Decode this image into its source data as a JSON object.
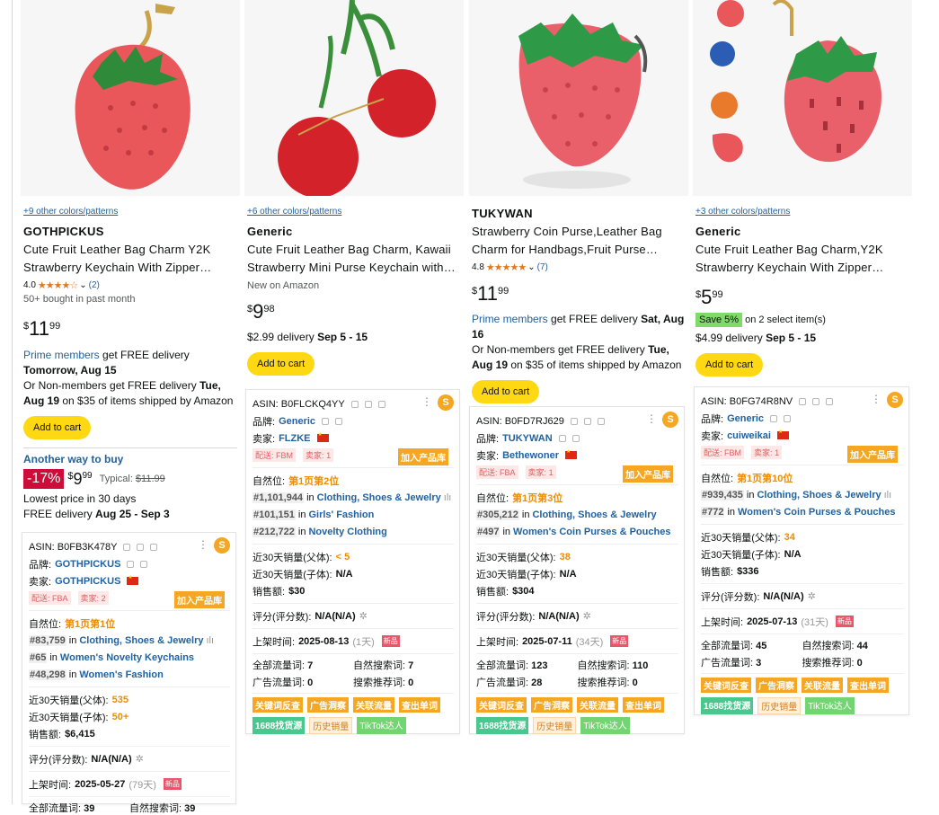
{
  "products": [
    {
      "colors": "+9 other colors/patterns",
      "brand": "GOTHPICKUS",
      "title1": "Cute Fruit Leather Bag Charm Y2K",
      "title2": "Strawberry Keychain With Zipper…",
      "rating": "4.0",
      "stars": "★★★★☆",
      "reviews": "(2)",
      "bought": "50+ bought in past month",
      "price_symbol": "$",
      "price_whole": "11",
      "price_frac": "99",
      "prime": "Prime members",
      "prime_rest": "get FREE delivery",
      "prime_date": "Tomorrow, Aug 15",
      "nonmember1": "Or Non-members get FREE delivery",
      "nonmember_date": "Tue,",
      "nonmember2_date": "Aug 19",
      "nonmember2": "on $35 of items shipped by Amazon",
      "cart": "Add to cart",
      "another": "Another way to buy",
      "discount": "-17%",
      "alt_whole": "9",
      "alt_frac": "99",
      "typical_label": "Typical:",
      "typical_price": "$11.99",
      "lowest": "Lowest price in 30 days",
      "free_deliv_label": "FREE delivery",
      "free_deliv_date": "Aug 25 - Sep 3"
    },
    {
      "colors": "+6 other colors/patterns",
      "brand": "Generic",
      "title1": "Cute Fruit Leather Bag Charm, Kawaii",
      "title2": "Strawberry Mini Purse Keychain with…",
      "new": "New on Amazon",
      "price_symbol": "$",
      "price_whole": "9",
      "price_frac": "98",
      "deliv_label": "$2.99 delivery",
      "deliv_date": "Sep 5 - 15",
      "cart": "Add to cart"
    },
    {
      "brand": "TUKYWAN",
      "title1": "Strawberry Coin Purse,Leather Bag",
      "title2": "Charm for Handbags,Fruit Purse…",
      "rating": "4.8",
      "stars": "★★★★★",
      "reviews": "(7)",
      "price_symbol": "$",
      "price_whole": "11",
      "price_frac": "99",
      "prime": "Prime members",
      "prime_rest": "get FREE delivery",
      "prime_date": "Sat, Aug",
      "prime_date2": "16",
      "nonmember1": "Or Non-members get FREE delivery",
      "nonmember_date": "Tue,",
      "nonmember2_date": "Aug 19",
      "nonmember2": "on $35 of items shipped by Amazon",
      "cart": "Add to cart"
    },
    {
      "colors": "+3 other colors/patterns",
      "brand": "Generic",
      "title1": "Cute Fruit Leather Bag Charm,Y2K",
      "title2": "Strawberry Keychain With Zipper…",
      "price_symbol": "$",
      "price_whole": "5",
      "price_frac": "99",
      "save": "Save 5%",
      "save_rest": "on 2 select item(s)",
      "deliv_label": "$4.99 delivery",
      "deliv_date": "Sep 5 - 15",
      "cart": "Add to cart"
    }
  ],
  "plugin_labels": {
    "brand": "品牌:",
    "seller": "卖家:",
    "ship_prefix": "配送:",
    "seller_count_prefix": "卖家:",
    "add_lib": "加入产品库",
    "natural": "自然位:",
    "in": "in",
    "sales30_parent": "近30天销量(父体):",
    "sales30_child": "近30天销量(子体):",
    "revenue": "销售额:",
    "rating": "评分(评分数):",
    "listed": "上架时间:",
    "new_tag": "新品",
    "all_traffic": "全部流量词:",
    "natural_search": "自然搜索词:",
    "ad_traffic": "广告流量词:",
    "search_rec": "搜索推荐词:",
    "btn1": "关键词反查",
    "btn2": "广告洞察",
    "btn3": "关联流量",
    "btn4": "查出单词",
    "btn5": "1688找货源",
    "btn6": "历史销量",
    "btn7": "TikTok达人",
    "s_icon": "S"
  },
  "plugins": [
    {
      "asin": "ASIN: B0FB3K478Y",
      "brand": "GOTHPICKUS",
      "seller": "GOTHPICKUS",
      "ship": "FBA",
      "sellers": "2",
      "natural_pos": "第1页第1位",
      "rank1_num": "#83,759",
      "rank1_cat": "Clothing, Shoes & Jewelry",
      "rank2_num": "#65",
      "rank2_cat": "Women's Novelty Keychains",
      "rank3_num": "#48,298",
      "rank3_cat": "Women's Fashion",
      "sales_parent": "535",
      "sales_child": "50+",
      "revenue": "$6,415",
      "rating_val": "N/A(N/A)",
      "listed": "2025-05-27",
      "listed_days": "(79天)",
      "all_traffic": "39",
      "natural_search": "39"
    },
    {
      "asin": "ASIN: B0FLCKQ4YY",
      "brand": "Generic",
      "seller": "FLZKE",
      "ship": "FBM",
      "sellers": "1",
      "natural_pos": "第1页第2位",
      "rank1_num": "#1,101,944",
      "rank1_cat": "Clothing, Shoes & Jewelry",
      "rank2_num": "#101,151",
      "rank2_cat": "Girls' Fashion",
      "rank3_num": "#212,722",
      "rank3_cat": "Novelty Clothing",
      "sales_parent": "< 5",
      "sales_child": "N/A",
      "revenue": "$30",
      "rating_val": "N/A(N/A)",
      "listed": "2025-08-13",
      "listed_days": "(1天)",
      "all_traffic": "7",
      "natural_search": "7",
      "ad_traffic": "0",
      "search_rec": "0"
    },
    {
      "asin": "ASIN: B0FD7RJ629",
      "brand": "TUKYWAN",
      "seller": "Bethewoner",
      "ship": "FBA",
      "sellers": "1",
      "natural_pos": "第1页第3位",
      "rank1_num": "#305,212",
      "rank1_cat": "Clothing, Shoes & Jewelry",
      "rank2_num": "#497",
      "rank2_cat": "Women's Coin Purses & Pouches",
      "sales_parent": "38",
      "sales_child": "N/A",
      "revenue": "$304",
      "rating_val": "N/A(N/A)",
      "listed": "2025-07-11",
      "listed_days": "(34天)",
      "all_traffic": "123",
      "natural_search": "110",
      "ad_traffic": "28",
      "search_rec": "0"
    },
    {
      "asin": "ASIN: B0FG74R8NV",
      "brand": "Generic",
      "seller": "cuiweikai",
      "ship": "FBM",
      "sellers": "1",
      "natural_pos": "第1页第10位",
      "rank1_num": "#939,435",
      "rank1_cat": "Clothing, Shoes & Jewelry",
      "rank2_num": "#772",
      "rank2_cat": "Women's Coin Purses & Pouches",
      "sales_parent": "34",
      "sales_child": "N/A",
      "revenue": "$336",
      "rating_val": "N/A(N/A)",
      "listed": "2025-07-13",
      "listed_days": "(31天)",
      "all_traffic": "45",
      "natural_search": "44",
      "ad_traffic": "3",
      "search_rec": "0"
    }
  ]
}
